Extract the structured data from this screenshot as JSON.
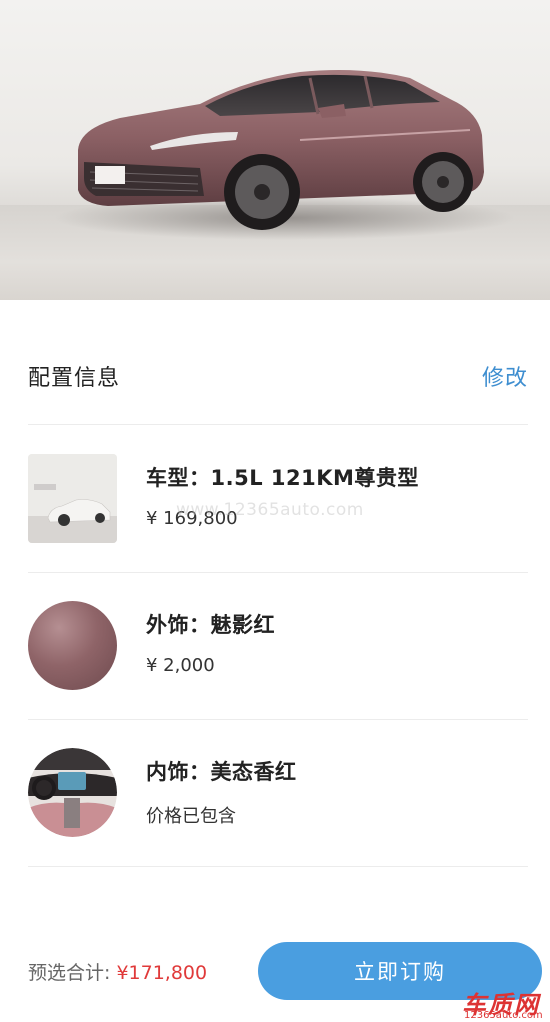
{
  "hero": {
    "image": "car-hero-image",
    "color": "#8b6064"
  },
  "config": {
    "title": "配置信息",
    "edit_label": "修改"
  },
  "items": [
    {
      "title": "车型：1.5L 121KM尊贵型",
      "price": "¥ 169,800",
      "thumb": "car-model-thumbnail"
    },
    {
      "title": "外饰：魅影红",
      "price": "¥ 2,000",
      "thumb": "exterior-color-swatch",
      "swatch_color": "#8f6468"
    },
    {
      "title": "内饰：美态香红",
      "price": "价格已包含",
      "thumb": "interior-thumbnail"
    }
  ],
  "watermark": "www.12365auto.com",
  "footer": {
    "total_label": "预选合计: ",
    "total_value": "¥171,800",
    "order_label": "立即订购"
  },
  "logo": {
    "text": "车质网",
    "url": "12365auto.com"
  },
  "colors": {
    "accent": "#4a9ee0",
    "link": "#3e8ed0",
    "price_red": "#e03a3a"
  }
}
